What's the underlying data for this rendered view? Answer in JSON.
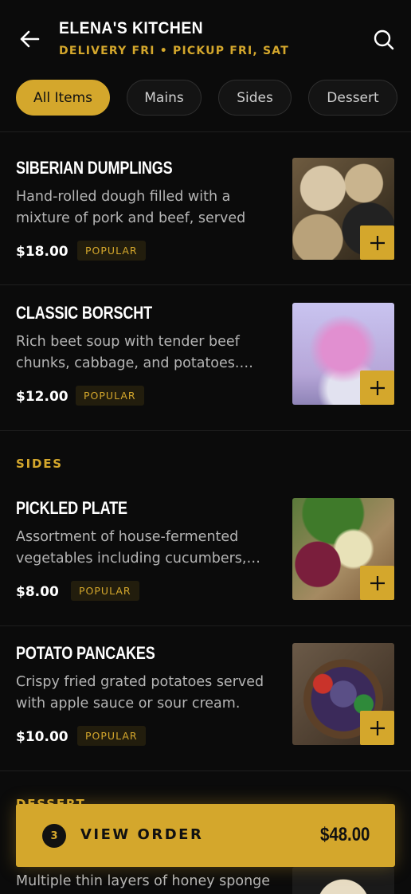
{
  "header": {
    "title": "ELENA'S KITCHEN",
    "subtitle": "DELIVERY FRI • PICKUP FRI, SAT",
    "back_icon": "arrow-left-icon",
    "search_icon": "search-icon"
  },
  "tabs": [
    {
      "label": "All Items",
      "active": true
    },
    {
      "label": "Mains",
      "active": false
    },
    {
      "label": "Sides",
      "active": false
    },
    {
      "label": "Dessert",
      "active": false
    }
  ],
  "items": [
    {
      "name": "SIBERIAN DUMPLINGS",
      "description": "Hand-rolled dough filled with a mixture of pork and beef, served wit…",
      "price": "$18.00",
      "badge": "POPULAR"
    },
    {
      "name": "CLASSIC BORSCHT",
      "description": "Rich beet soup with tender beef chunks, cabbage, and potatoes.…",
      "price": "$12.00",
      "badge": "POPULAR"
    },
    {
      "name": "PICKLED PLATE",
      "description": "Assortment of house-fermented vegetables including cucumbers,…",
      "price": "$8.00",
      "badge": "POPULAR"
    },
    {
      "name": "POTATO PANCAKES",
      "description": "Crispy fried grated potatoes served with apple sauce or sour cream.",
      "price": "$10.00",
      "badge": "POPULAR"
    }
  ],
  "sections": {
    "sides": "SIDES",
    "dessert": "DESSERT"
  },
  "partial_item": {
    "description": "Multiple thin layers of honey sponge"
  },
  "order_bar": {
    "count": "3",
    "label": "VIEW ORDER",
    "total": "$48.00"
  },
  "colors": {
    "accent": "#d4a72c",
    "background": "#0b0b0b"
  }
}
